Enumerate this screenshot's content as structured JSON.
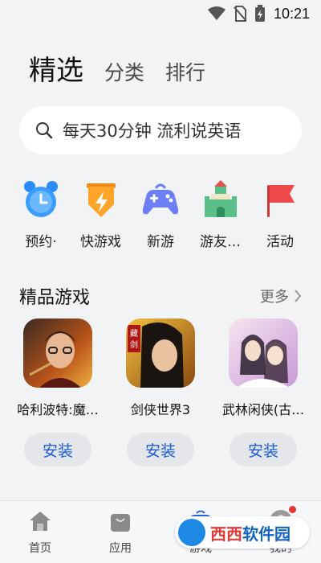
{
  "status_bar": {
    "time": "10:21"
  },
  "top_tabs": [
    {
      "label": "精选",
      "active": true
    },
    {
      "label": "分类",
      "active": false
    },
    {
      "label": "排行",
      "active": false
    }
  ],
  "search": {
    "placeholder": "每天30分钟 流利说英语"
  },
  "quick_links": [
    {
      "label": "预约·",
      "icon": "alarm-clock-icon"
    },
    {
      "label": "快游戏",
      "icon": "lightning-shield-icon"
    },
    {
      "label": "新游",
      "icon": "gamepad-icon"
    },
    {
      "label": "游友…",
      "icon": "castle-icon"
    },
    {
      "label": "活动",
      "icon": "flag-icon"
    }
  ],
  "featured": {
    "title": "精品游戏",
    "more": "更多",
    "games": [
      {
        "name": "哈利波特:魔…",
        "button": "安装"
      },
      {
        "name": "剑侠世界3",
        "button": "安装"
      },
      {
        "name": "武林闲侠(古…",
        "button": "安装"
      }
    ]
  },
  "bottom_nav": [
    {
      "label": "首页",
      "icon": "home-icon"
    },
    {
      "label": "应用",
      "icon": "shopping-bag-icon"
    },
    {
      "label": "游戏",
      "icon": "gamepad-icon",
      "active": true
    },
    {
      "label": "我的",
      "icon": "profile-icon"
    }
  ],
  "watermark": {
    "part1": "西西",
    "part2": "软件园"
  },
  "colors": {
    "accent": "#1a5bd8",
    "background": "#f2f3f5"
  }
}
